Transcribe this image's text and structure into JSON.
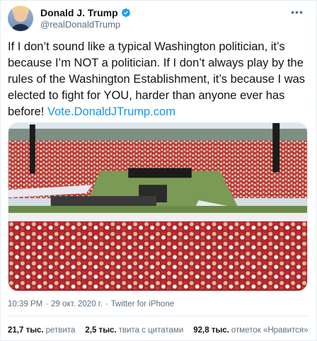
{
  "author": {
    "display_name": "Donald J. Trump",
    "handle": "@realDonaldTrump",
    "verified_icon": "verified-badge-icon",
    "avatar_icon": "profile-avatar"
  },
  "tweet": {
    "text": "If I don’t sound like a typical Washington politician, it’s because I’m NOT a politician. If I don’t always play by the rules of the Washington Establishment, it’s because I was elected to fight for YOU, harder than anyone ever has before! ",
    "link": "Vote.DonaldJTrump.com",
    "media_icon": "rally-crowd-photo"
  },
  "meta": {
    "time": "10:39 PM",
    "separator1": "·",
    "date": "29 окт. 2020 г.",
    "separator2": "·",
    "source": "Twitter for iPhone"
  },
  "stats": [
    {
      "value": "21,7 тыс.",
      "label": "ретвита"
    },
    {
      "value": "2,5 тыс.",
      "label": "твита с цитатами"
    },
    {
      "value": "92,8 тыс.",
      "label": "отметок «Нравится»"
    }
  ],
  "colors": {
    "link": "#1b95e0",
    "verified": "#1da1f2",
    "secondary_text": "#5b7083"
  }
}
